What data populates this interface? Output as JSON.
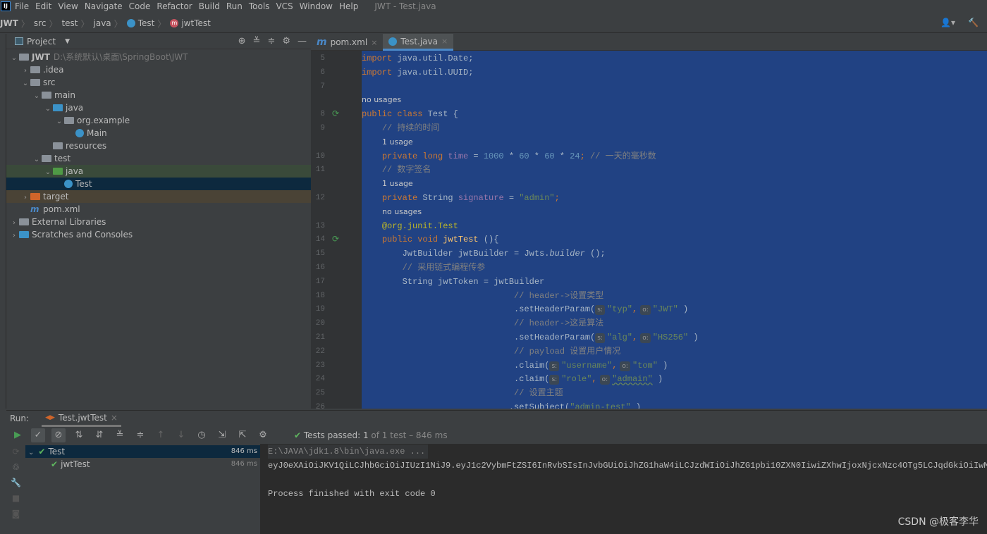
{
  "window": {
    "title": "JWT - Test.java",
    "logo": "IJ"
  },
  "menu": [
    "File",
    "Edit",
    "View",
    "Navigate",
    "Code",
    "Refactor",
    "Build",
    "Run",
    "Tools",
    "VCS",
    "Window",
    "Help"
  ],
  "breadcrumb": [
    "JWT",
    "src",
    "test",
    "java",
    "Test",
    "jwtTest"
  ],
  "project": {
    "title": "Project",
    "tree": [
      {
        "label": "JWT",
        "extra": "D:\\系统默认\\桌面\\SpringBoot\\JWT",
        "depth": 0,
        "arrow": "v",
        "icon": "module-folder-icon",
        "color": "#8a9199"
      },
      {
        "label": ".idea",
        "depth": 1,
        "arrow": ">",
        "icon": "folder-icon",
        "color": "#8a9199"
      },
      {
        "label": "src",
        "depth": 1,
        "arrow": "v",
        "icon": "folder-icon",
        "color": "#8a9199"
      },
      {
        "label": "main",
        "depth": 2,
        "arrow": "v",
        "icon": "folder-icon",
        "color": "#8a9199"
      },
      {
        "label": "java",
        "depth": 3,
        "arrow": "v",
        "icon": "source-folder-icon",
        "color": "#3b92c7"
      },
      {
        "label": "org.example",
        "depth": 4,
        "arrow": "v",
        "icon": "package-icon",
        "color": "#8a9199"
      },
      {
        "label": "Main",
        "depth": 5,
        "arrow": "",
        "icon": "class-icon",
        "color": "#3b92c7"
      },
      {
        "label": "resources",
        "depth": 3,
        "arrow": "",
        "icon": "resources-folder-icon",
        "color": "#8a9199"
      },
      {
        "label": "test",
        "depth": 2,
        "arrow": "v",
        "icon": "folder-icon",
        "color": "#8a9199"
      },
      {
        "label": "java",
        "depth": 3,
        "arrow": "v",
        "icon": "test-folder-icon",
        "color": "#4f9a46",
        "state": "green"
      },
      {
        "label": "Test",
        "depth": 4,
        "arrow": "",
        "icon": "class-icon",
        "color": "#3b92c7",
        "state": "sel"
      },
      {
        "label": "target",
        "depth": 1,
        "arrow": ">",
        "icon": "excluded-folder-icon",
        "color": "#d0652a",
        "state": "brown"
      },
      {
        "label": "pom.xml",
        "depth": 1,
        "arrow": "",
        "icon": "maven-icon",
        "color": "#4a88c7"
      },
      {
        "label": "External Libraries",
        "depth": 0,
        "arrow": ">",
        "icon": "libraries-icon",
        "color": "#8a9199"
      },
      {
        "label": "Scratches and Consoles",
        "depth": 0,
        "arrow": ">",
        "icon": "scratches-icon",
        "color": "#3b92c7"
      }
    ]
  },
  "tabs": [
    {
      "label": "pom.xml",
      "icon": "maven-icon",
      "active": false
    },
    {
      "label": "Test.java",
      "icon": "class-icon",
      "active": true
    }
  ],
  "editor": {
    "lines": [
      {
        "n": "5",
        "t": [
          [
            "kw",
            "import"
          ],
          [
            "",
            "java.util.Date;"
          ]
        ]
      },
      {
        "n": "6",
        "t": [
          [
            "kw",
            "import"
          ],
          [
            "",
            "java.util.UUID;"
          ]
        ]
      },
      {
        "n": "7",
        "t": []
      },
      {
        "inlay": "no usages",
        "ind": 0
      },
      {
        "n": "8",
        "run": true,
        "t": [
          [
            "kw",
            "public class"
          ],
          [
            "",
            "Test {"
          ]
        ]
      },
      {
        "n": "9",
        "t": [
          [
            "",
            "    "
          ],
          [
            "cm",
            "// 持续的时间"
          ]
        ]
      },
      {
        "inlay": "1 usage",
        "ind": 4
      },
      {
        "n": "10",
        "t": [
          [
            "",
            "    "
          ],
          [
            "kw",
            "private long"
          ],
          [
            "fld",
            "time"
          ],
          [
            "",
            "="
          ],
          [
            "num",
            "1000"
          ],
          [
            "",
            "*"
          ],
          [
            "num",
            "60"
          ],
          [
            "",
            "*"
          ],
          [
            "num",
            "60"
          ],
          [
            "",
            "*"
          ],
          [
            "num",
            "24"
          ],
          [
            "kw",
            ";"
          ],
          [
            "cm",
            "// 一天的毫秒数"
          ]
        ]
      },
      {
        "n": "11",
        "t": [
          [
            "",
            "    "
          ],
          [
            "cm",
            "// 数字签名"
          ]
        ]
      },
      {
        "inlay": "1 usage",
        "ind": 4
      },
      {
        "n": "12",
        "t": [
          [
            "",
            "    "
          ],
          [
            "kw",
            "private"
          ],
          [
            "",
            "String"
          ],
          [
            "fld",
            "signature"
          ],
          [
            "",
            "="
          ],
          [
            "str",
            "\"admin\""
          ],
          [
            "kw",
            ";"
          ]
        ]
      },
      {
        "inlay": "no usages",
        "ind": 4
      },
      {
        "n": "13",
        "t": [
          [
            "",
            "    "
          ],
          [
            "ann",
            "@org.junit.Test"
          ]
        ]
      },
      {
        "n": "14",
        "run": true,
        "t": [
          [
            "",
            "    "
          ],
          [
            "kw",
            "public void"
          ],
          [
            "mth",
            "jwtTest"
          ],
          [
            "",
            "(){"
          ]
        ]
      },
      {
        "n": "15",
        "t": [
          [
            "",
            "        JwtBuilder jwtBuilder = Jwts."
          ],
          [
            "it",
            "builder"
          ],
          [
            "",
            "();"
          ]
        ]
      },
      {
        "n": "16",
        "t": [
          [
            "",
            "        "
          ],
          [
            "cm",
            "// 采用链式编程传参"
          ]
        ]
      },
      {
        "n": "17",
        "t": [
          [
            "",
            "        String jwtToken = jwtBuilder"
          ]
        ]
      },
      {
        "n": "18",
        "t": [
          [
            "",
            "                              "
          ],
          [
            "cm",
            "// header->设置类型"
          ]
        ]
      },
      {
        "n": "19",
        "t": [
          [
            "",
            "                              .setHeaderParam("
          ],
          [
            "ph",
            "s:"
          ],
          [
            "str",
            "\"typ\""
          ],
          [
            "kw",
            ","
          ],
          [
            "ph",
            "o:"
          ],
          [
            "str",
            "\"JWT\""
          ],
          [
            "",
            ")"
          ]
        ]
      },
      {
        "n": "20",
        "t": [
          [
            "",
            "                              "
          ],
          [
            "cm",
            "// header->这是算法"
          ]
        ]
      },
      {
        "n": "21",
        "t": [
          [
            "",
            "                              .setHeaderParam("
          ],
          [
            "ph",
            "s:"
          ],
          [
            "str",
            "\"alg\""
          ],
          [
            "kw",
            ","
          ],
          [
            "ph",
            "o:"
          ],
          [
            "str",
            "\"HS256\""
          ],
          [
            "",
            ")"
          ]
        ]
      },
      {
        "n": "22",
        "t": [
          [
            "",
            "                              "
          ],
          [
            "cm",
            "// payload 设置用户情况"
          ]
        ]
      },
      {
        "n": "23",
        "t": [
          [
            "",
            "                              .claim("
          ],
          [
            "ph",
            "s:"
          ],
          [
            "str",
            "\"username\""
          ],
          [
            "kw",
            ","
          ],
          [
            "ph",
            "o:"
          ],
          [
            "str",
            "\"tom\""
          ],
          [
            "",
            ")"
          ]
        ]
      },
      {
        "n": "24",
        "t": [
          [
            "",
            "                              .claim("
          ],
          [
            "ph",
            "s:"
          ],
          [
            "str",
            "\"role\""
          ],
          [
            "kw",
            ","
          ],
          [
            "ph",
            "o:"
          ],
          [
            "str",
            "\"admain\""
          ],
          [
            "",
            ")"
          ]
        ]
      },
      {
        "n": "25",
        "t": [
          [
            "",
            "                              "
          ],
          [
            "cm",
            "// 设置主题"
          ]
        ]
      },
      {
        "n": "26",
        "t": [
          [
            "",
            "                             .setSubject("
          ],
          [
            "str",
            "\"admin-test\""
          ],
          [
            "",
            ")"
          ]
        ]
      }
    ]
  },
  "run": {
    "label": "Run:",
    "tab": "Test.jwtTest",
    "status": {
      "prefix": "Tests passed:",
      "count": "1",
      "rest": "of 1 test – 846 ms"
    },
    "tree": [
      {
        "label": "Test",
        "time": "846 ms",
        "sel": true,
        "depth": 0
      },
      {
        "label": "jwtTest",
        "time": "846 ms",
        "sel": false,
        "depth": 1
      }
    ],
    "console": [
      "E:\\JAVA\\jdk1.8\\bin\\java.exe ...",
      "eyJ0eXAiOiJKV1QiLCJhbGciOiJIUzI1NiJ9.eyJ1c2VybmFtZSI6InRvbSIsInJvbGUiOiJhZG1haW4iLCJzdWIiOiJhZG1pbi10ZXN0IiwiZXhwIjoxNjcxNzc4OTg5LCJqdGkiOiIwM",
      "",
      "Process finished with exit code 0"
    ]
  },
  "watermark": "CSDN @极客李华",
  "colors": {
    "selection": "#214283",
    "keyword": "#cc7832",
    "string": "#6a8759",
    "pass": "#5fb85f"
  }
}
